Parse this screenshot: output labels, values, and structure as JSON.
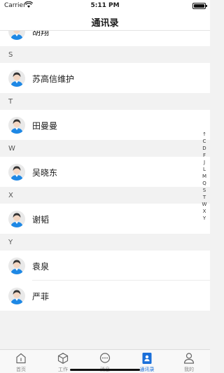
{
  "status": {
    "carrier": "Carrier",
    "time": "5:11 PM"
  },
  "nav": {
    "title": "通讯录"
  },
  "contacts": {
    "partial_name": "胡翔",
    "sections": [
      {
        "letter": "S",
        "names": [
          "苏高信维护"
        ]
      },
      {
        "letter": "T",
        "names": [
          "田曼曼"
        ]
      },
      {
        "letter": "W",
        "names": [
          "吴晓东"
        ]
      },
      {
        "letter": "X",
        "names": [
          "谢韬"
        ]
      },
      {
        "letter": "Y",
        "names": [
          "袁泉",
          "严菲"
        ]
      }
    ]
  },
  "index": [
    "↑",
    "C",
    "D",
    "F",
    "J",
    "L",
    "M",
    "Q",
    "S",
    "T",
    "W",
    "X",
    "Y"
  ],
  "tabs": [
    {
      "label": "首页",
      "icon": "home-icon"
    },
    {
      "label": "工作",
      "icon": "cube-icon"
    },
    {
      "label": "消息",
      "icon": "chat-icon"
    },
    {
      "label": "通讯录",
      "icon": "contacts-icon",
      "active": true
    },
    {
      "label": "我的",
      "icon": "person-icon"
    }
  ],
  "colors": {
    "accent": "#1a6fd9",
    "avatar_shirt": "#1e88e5"
  }
}
